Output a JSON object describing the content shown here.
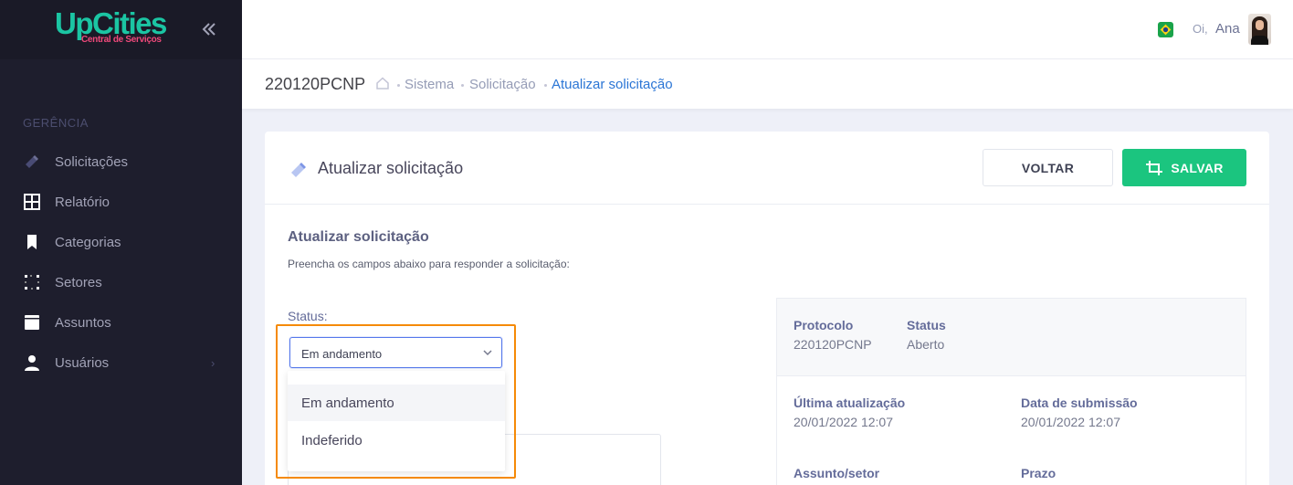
{
  "sidebar": {
    "logo_main": "UpCities",
    "logo_sub": "Central de Serviços",
    "section": "GERÊNCIA",
    "items": [
      {
        "label": "Solicitações",
        "icon": "ticket-icon"
      },
      {
        "label": "Relatório",
        "icon": "grid-icon"
      },
      {
        "label": "Categorias",
        "icon": "bookmark-icon"
      },
      {
        "label": "Setores",
        "icon": "dotted-square-icon"
      },
      {
        "label": "Assuntos",
        "icon": "book-icon"
      },
      {
        "label": "Usuários",
        "icon": "user-icon"
      }
    ],
    "submenu_arrow": "›"
  },
  "header": {
    "greeting": "Oi,",
    "username": "Ana",
    "flag": "brazil-flag-icon"
  },
  "subheader": {
    "title": "220120PCNP",
    "breadcrumbs": [
      "Sistema",
      "Solicitação",
      "Atualizar solicitação"
    ]
  },
  "card": {
    "title": "Atualizar solicitação",
    "back_label": "VOLTAR",
    "save_label": "SALVAR"
  },
  "form": {
    "title": "Atualizar solicitação",
    "description": "Preencha os campos abaixo para responder a solicitação:",
    "status_label": "Status:",
    "status_value": "Em andamento",
    "options": [
      "Em andamento",
      "Indeferido"
    ]
  },
  "info": {
    "protocolo_label": "Protocolo",
    "protocolo_value": "220120PCNP",
    "status_label": "Status",
    "status_value": "Aberto",
    "ultima_label": "Última atualização",
    "ultima_value": "20/01/2022 12:07",
    "submissao_label": "Data de submissão",
    "submissao_value": "20/01/2022 12:07",
    "assunto_label": "Assunto/setor",
    "prazo_label": "Prazo"
  },
  "colors": {
    "sidebar_bg": "#1e1e2d",
    "brand": "#1bc5a3",
    "save": "#1bc57f",
    "link": "#2a75d5",
    "highlight": "#f58a07"
  }
}
